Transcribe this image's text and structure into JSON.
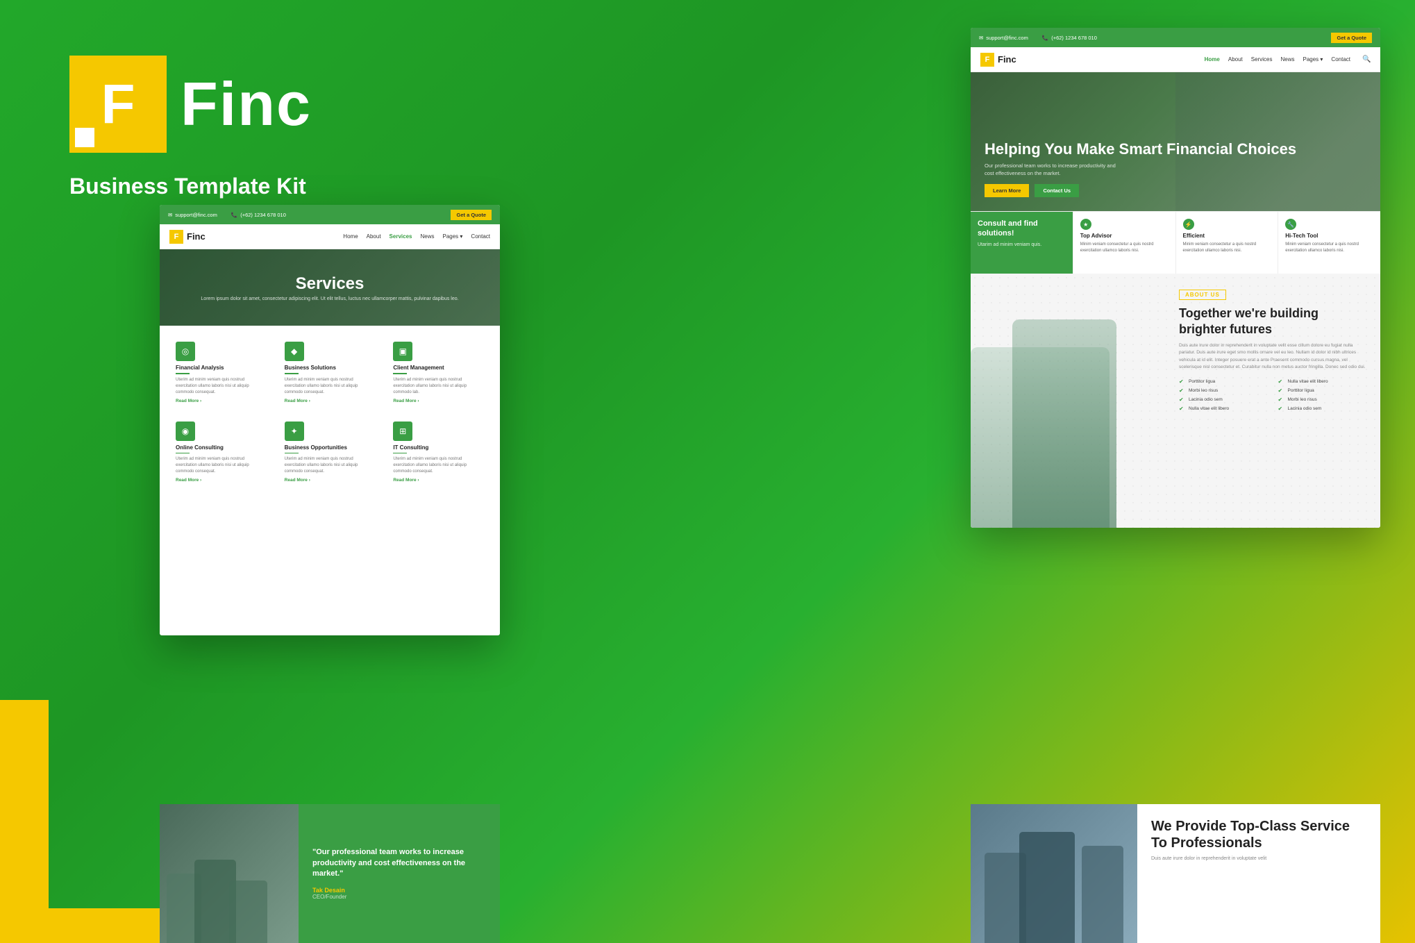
{
  "background": {
    "gradient_start": "#22a82a",
    "gradient_end": "#e6c200"
  },
  "brand": {
    "name": "Finc",
    "tagline": "Business Template Kit"
  },
  "topbar": {
    "email": "support@finc.com",
    "phone": "(+62) 1234 678 010",
    "quote_btn": "Get a Quote"
  },
  "nav": {
    "logo": "Finc",
    "links": [
      "Home",
      "About",
      "Services",
      "News",
      "Pages",
      "Contact"
    ]
  },
  "hero": {
    "title": "Helping You Make Smart Financial Choices",
    "subtitle": "Our professional team works to increase productivity and cost effectiveness on the market.",
    "btn_learn": "Learn More",
    "btn_contact": "Contact Us"
  },
  "features": [
    {
      "title": "Consult and find solutions!",
      "text": "Utarim ad minim veniam quis."
    },
    {
      "title": "Top Advisor",
      "text": "Minim veniam consectetur a quis nostrd exercitation ullamco laboris nisi."
    },
    {
      "title": "Efficient",
      "text": "Minim veniam consectetur a quis nostrd exercitation ullamco laboris nisi."
    },
    {
      "title": "Hi-Tech Tool",
      "text": "Minim veniam consectetur a quis nostrd exercitation ullamco laboris nisi."
    }
  ],
  "services_page": {
    "title": "Services",
    "subtitle": "Lorem ipsum dolor sit amet, consectetur adipiscing elit. Ut elit tellus, luctus nec ullamcorper mattis, pulvinar dapibus leo.",
    "items": [
      {
        "icon": "◎",
        "title": "Financial Analysis",
        "text": "Uterim ad minim veniam quis nostrud exercitation ullamo laboris nisi ut aliquip commodo consequat.",
        "read_more": "Read More ›"
      },
      {
        "icon": "◆",
        "title": "Business Solutions",
        "text": "Uterim ad minim veniam quis nostrud exercitation ullamo laboris nisi ut aliquip commodo consequat.",
        "read_more": "Read More ›"
      },
      {
        "icon": "▣",
        "title": "Client Management",
        "text": "Uterim ad minim veniam quis nostrud exercitation ullamo laboris nisi ut aliquip commodo lab.",
        "read_more": "Read More ›"
      },
      {
        "icon": "◉",
        "title": "Online Consulting",
        "text": "Uterim ad minim veniam quis nostrud exercitation ullamo laboris nisi ut aliquip commodo consequat.",
        "read_more": "Read More ›"
      },
      {
        "icon": "✦",
        "title": "Business Opportunities",
        "text": "Uterim ad minim veniam quis nostrud exercitation ullamo laboris nisi ut aliquip commodo consequat.",
        "read_more": "Read More ›"
      },
      {
        "icon": "⊞",
        "title": "IT Consulting",
        "text": "Uterim ad minim veniam quis nostrud exercitation ullamo laboris nisi ut aliquip commodo consequat.",
        "read_more": "Read More ›"
      }
    ]
  },
  "about": {
    "label": "ABOUT US",
    "title": "Together we're building brighter futures",
    "text": "Duis aute irure dolor in reprehenderit in voluptate velit esse cillum dolore eu fugiat nulla pariatur. Duis aute irure eget smo mollis ornare vel eu leo. Nullam id dolor id nibh ultrices vehicula at id elit. Integer posuere erat a ante Praesent commodo cursus magna, vel scelerisque nisl consectetur et. Curabitur nulla non metus auctor fringilla. Donec sed odio dui.",
    "checklist": [
      "Porttitor ligua",
      "Morbi leo risus",
      "Lacinia odio sem",
      "Nulla vitae elit libero",
      "Nulla vitae elit libero",
      "Porttitor ligua",
      "Morbi leo risus",
      "Lacinia odio sem"
    ]
  },
  "testimonial": {
    "quote": "\"Our professional team works to increase productivity and cost effectiveness on the market.\"",
    "author": "Tak Desain",
    "role": "CEO/Founder"
  },
  "bottom_service": {
    "title": "We Provide Top-Class Service To Professionals",
    "text": "Duis aute irure dolor in reprehenderit in voluptate velit"
  }
}
